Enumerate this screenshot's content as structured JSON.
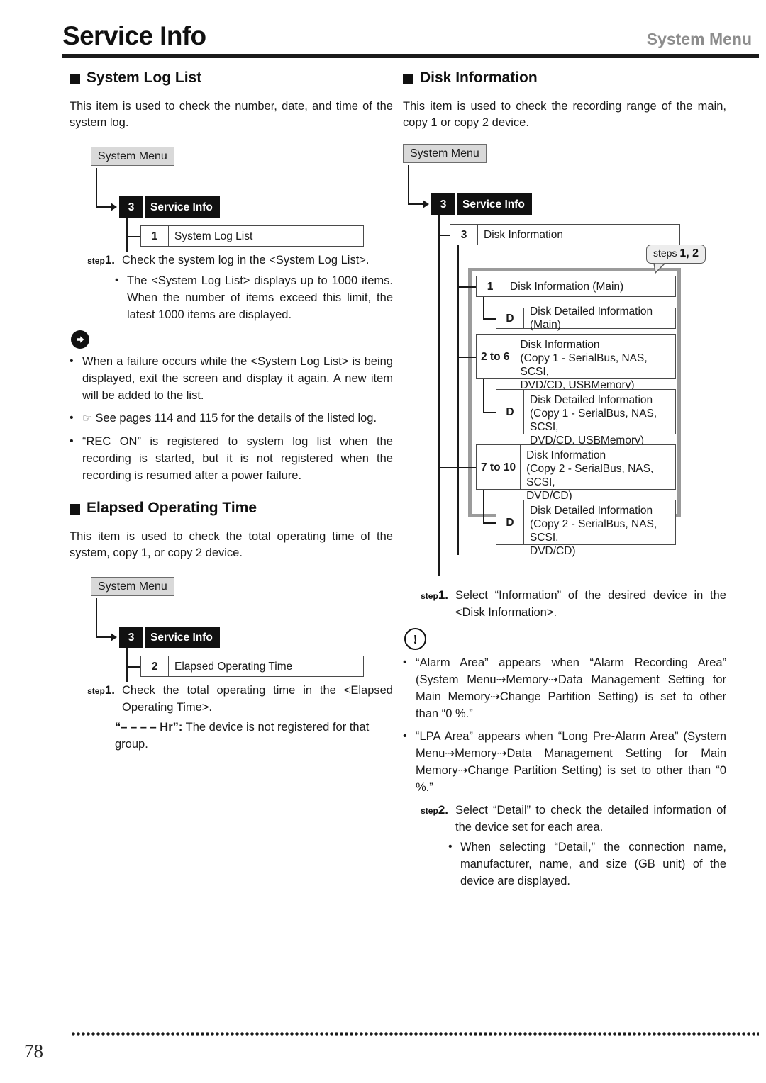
{
  "header": {
    "title": "Service Info",
    "right_label": "System Menu"
  },
  "left_column": {
    "section1": {
      "heading": "System Log List",
      "intro": "This item is used to check the number, date, and time of the system log.",
      "tree": {
        "root": "System Menu",
        "service": {
          "num": "3",
          "label": "Service Info"
        },
        "child": {
          "num": "1",
          "label": "System Log List"
        }
      },
      "steps": [
        {
          "label_prefix": "step",
          "label_num": "1.",
          "text": "Check the system log in the <System Log List>.",
          "subs": [
            "The <System Log List> displays up to 1000 items. When the number of items exceed this limit, the latest 1000 items are displayed."
          ]
        }
      ],
      "note_icon": "arrow-circle-icon",
      "notes": [
        "When a failure occurs while the <System Log List> is being displayed, exit the screen and display it again. A new item will be added to the list.",
        "See pages 114 and 115 for the details of the listed log.",
        "“REC ON” is registered to system log list when the recording is started, but it is not registered when the recording is resumed after a power failure."
      ],
      "note_hand_index": 1,
      "hand_glyph": "☞"
    },
    "section2": {
      "heading": "Elapsed Operating Time",
      "intro": "This item is used to check the total operating time of the system, copy 1, or copy 2 device.",
      "tree": {
        "root": "System Menu",
        "service": {
          "num": "3",
          "label": "Service Info"
        },
        "child": {
          "num": "2",
          "label": "Elapsed Operating Time"
        }
      },
      "steps": [
        {
          "label_prefix": "step",
          "label_num": "1.",
          "text": "Check the total operating time in the <Elapsed Operating Time>.",
          "extra_bold": "“– – – – Hr”:",
          "extra_text": " The device is not registered for that group."
        }
      ]
    }
  },
  "right_column": {
    "section1": {
      "heading": "Disk Information",
      "intro": "This item is used to check the recording range of the main, copy 1 or copy 2 device.",
      "tree": {
        "root": "System Menu",
        "service": {
          "num": "3",
          "label": "Service Info"
        },
        "child": {
          "num": "3",
          "label": "Disk Information"
        },
        "callout": {
          "prefix": "steps",
          "value": "1, 2"
        },
        "group": [
          {
            "num": "1",
            "label": "Disk Information (Main)"
          },
          {
            "num": "D",
            "label": "Disk Detailed Information (Main)"
          },
          {
            "num": "2 to 6",
            "label": "Disk Information\n(Copy 1 - SerialBus, NAS, SCSI,\nDVD/CD, USBMemory)"
          },
          {
            "num": "D",
            "label": "Disk Detailed Information\n(Copy 1 - SerialBus, NAS, SCSI,\nDVD/CD, USBMemory)"
          },
          {
            "num": "7 to 10",
            "label": "Disk Information\n(Copy 2 - SerialBus, NAS, SCSI,\nDVD/CD)"
          },
          {
            "num": "D",
            "label": "Disk Detailed Information\n(Copy 2 - SerialBus, NAS, SCSI,\nDVD/CD)"
          }
        ]
      },
      "steps": [
        {
          "label_prefix": "step",
          "label_num": "1.",
          "text": "Select “Information” of the desired device in the <Disk Information>."
        },
        {
          "label_prefix": "step",
          "label_num": "2.",
          "text": "Select “Detail” to check the detailed information of the device set for each area.",
          "subs": [
            "When selecting “Detail,” the connection name, manufacturer, name, and size (GB unit) of the device are displayed."
          ]
        }
      ],
      "caution_icon": "exclamation-circle-icon",
      "cautions": [
        "“Alarm Area” appears when “Alarm Recording Area” (System Menu⇢Memory⇢Data Management Setting for Main Memory⇢Change Partition Setting) is set to other than “0 %.”",
        "“LPA Area” appears when “Long Pre-Alarm Area” (System Menu⇢Memory⇢Data Management Setting for Main Memory⇢Change Partition Setting) is set to other than “0 %.”"
      ]
    }
  },
  "footer": {
    "page_number": "78"
  },
  "colors": {
    "ink": "#1a1a1a",
    "header_right": "#8d8d8d",
    "root_box_fill": "#d9d9d9",
    "service_box_fill": "#111111",
    "group_frame": "#9b9b9b",
    "callout_fill": "#ededed"
  }
}
